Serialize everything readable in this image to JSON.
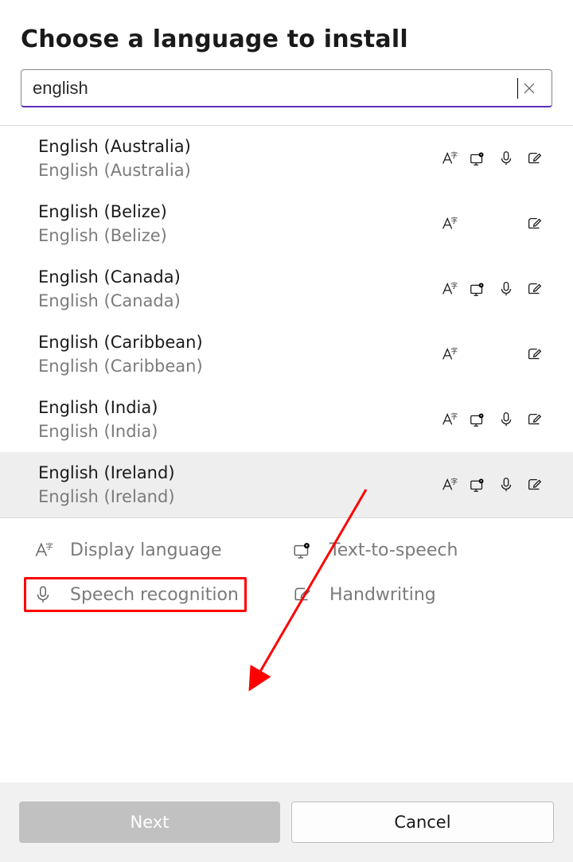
{
  "header": {
    "title": "Choose a language to install"
  },
  "search": {
    "value": "english",
    "clear_icon": "close"
  },
  "languages": [
    {
      "primary": "English (Australia)",
      "native": "English (Australia)",
      "features": {
        "display": true,
        "tts": true,
        "speech": true,
        "hand": true
      },
      "selected": false
    },
    {
      "primary": "English (Belize)",
      "native": "English (Belize)",
      "features": {
        "display": true,
        "tts": false,
        "speech": false,
        "hand": true
      },
      "selected": false
    },
    {
      "primary": "English (Canada)",
      "native": "English (Canada)",
      "features": {
        "display": true,
        "tts": true,
        "speech": true,
        "hand": true
      },
      "selected": false
    },
    {
      "primary": "English (Caribbean)",
      "native": "English (Caribbean)",
      "features": {
        "display": true,
        "tts": false,
        "speech": false,
        "hand": true
      },
      "selected": false
    },
    {
      "primary": "English (India)",
      "native": "English (India)",
      "features": {
        "display": true,
        "tts": true,
        "speech": true,
        "hand": true
      },
      "selected": false
    },
    {
      "primary": "English (Ireland)",
      "native": "English (Ireland)",
      "features": {
        "display": true,
        "tts": true,
        "speech": true,
        "hand": true
      },
      "selected": true
    }
  ],
  "legend": {
    "display": "Display language",
    "tts": "Text-to-speech",
    "speech": "Speech recognition",
    "hand": "Handwriting"
  },
  "footer": {
    "next": "Next",
    "cancel": "Cancel"
  },
  "annotation": {
    "arrow_color": "#ff0000"
  }
}
